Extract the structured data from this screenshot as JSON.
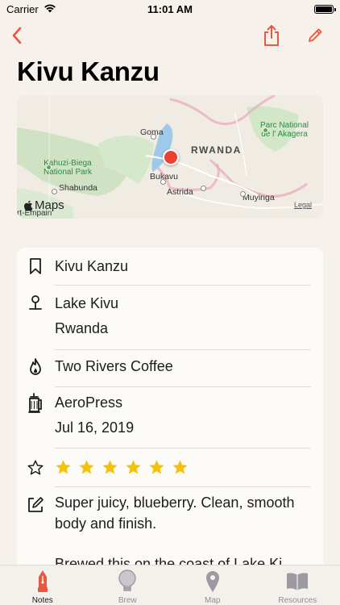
{
  "status_bar": {
    "carrier": "Carrier",
    "time": "11:01 AM"
  },
  "nav": {
    "back_icon": "chevron-left-icon",
    "share_icon": "share-icon",
    "edit_icon": "pencil-icon",
    "accent_color": "#e8573f"
  },
  "title": "Kivu Kanzu",
  "map": {
    "labels": {
      "goma": "Goma",
      "rwanda": "RWANDA",
      "park_akagera": "Parc National\nde l' Akagera",
      "kahuzi": "Kahuzi-Biega\nNational Park",
      "bukavu": "Bukavu",
      "shabunda": "Shabunda",
      "astrida": "Astrida",
      "muyinga": "Muyinga",
      "port_empain": "rt-Empain"
    },
    "logo_text": "Maps",
    "legal_text": "Legal",
    "pin_color": "#e8432e"
  },
  "details": {
    "name": "Kivu Kanzu",
    "region": "Lake Kivu",
    "country": "Rwanda",
    "roaster": "Two Rivers Coffee",
    "brew_method": "AeroPress",
    "date": "Jul 16, 2019",
    "rating": 6,
    "rating_max": 6,
    "star_color": "#f4c20d",
    "notes_line1": "Super juicy, blueberry. Clean, smooth",
    "notes_line2": "body and finish.",
    "notes_line3": "Brewed this on the coast of Lake Ki"
  },
  "tabs": [
    {
      "label": "Notes",
      "icon": "notes-pen-icon",
      "active": true
    },
    {
      "label": "Brew",
      "icon": "brew-lightbulb-icon",
      "active": false
    },
    {
      "label": "Map",
      "icon": "map-pin-icon",
      "active": false
    },
    {
      "label": "Resources",
      "icon": "book-icon",
      "active": false
    }
  ]
}
